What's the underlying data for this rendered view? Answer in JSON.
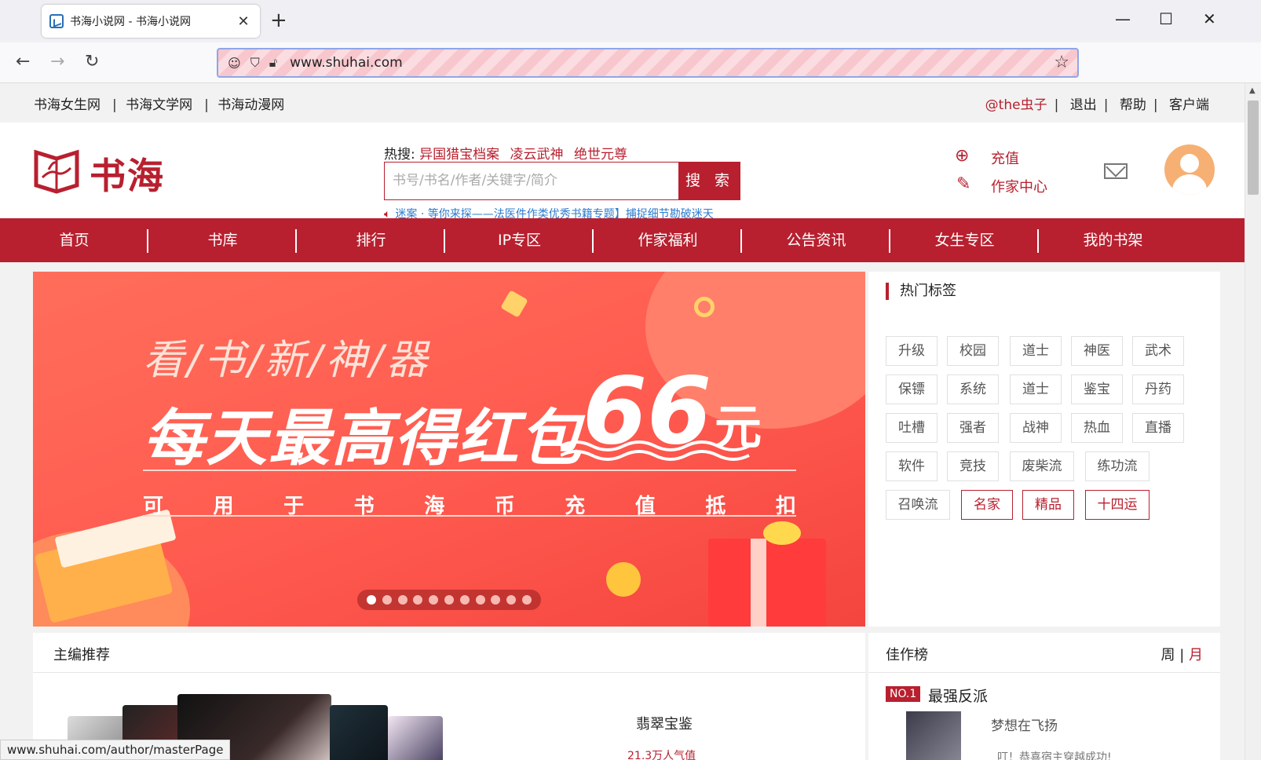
{
  "browser": {
    "tab_title": "书海小说网 - 书海小说网",
    "url": "www.shuhai.com",
    "status_url": "www.shuhai.com/author/masterPage"
  },
  "topbar": {
    "links": [
      "书海女生网",
      "书海文学网",
      "书海动漫网"
    ],
    "user": "@the虫子",
    "logout": "退出",
    "help": "帮助",
    "client": "客户端"
  },
  "header": {
    "logo_text": "书海",
    "hot_label": "热搜:",
    "hot_keywords": [
      "异国猎宝档案",
      "凌云武神",
      "绝世元尊"
    ],
    "search_placeholder": "书号/书名/作者/关键字/简介",
    "search_button": "搜 索",
    "notice": "迷案 · 等你来探——法医件作类优秀书籍专题】捕捉细节勘破迷天",
    "recharge": "充值",
    "writer_center": "作家中心"
  },
  "menu": [
    "首页",
    "书库",
    "排行",
    "IP专区",
    "作家福利",
    "公告资讯",
    "女生专区",
    "我的书架"
  ],
  "banner": {
    "line1": "看/书/新/神/器",
    "line2": "每天最高得红包",
    "amount": "66",
    "unit": "元",
    "line3": [
      "可",
      "用",
      "于",
      "书",
      "海",
      "币",
      "充",
      "值",
      "抵",
      "扣"
    ],
    "slide_count": 11,
    "active_slide": 0
  },
  "tags": {
    "title": "热门标签",
    "items": [
      {
        "label": "升级",
        "highlight": false
      },
      {
        "label": "校园",
        "highlight": false
      },
      {
        "label": "道士",
        "highlight": false
      },
      {
        "label": "神医",
        "highlight": false
      },
      {
        "label": "武术",
        "highlight": false
      },
      {
        "label": "保镖",
        "highlight": false
      },
      {
        "label": "系统",
        "highlight": false
      },
      {
        "label": "道士",
        "highlight": false
      },
      {
        "label": "鉴宝",
        "highlight": false
      },
      {
        "label": "丹药",
        "highlight": false
      },
      {
        "label": "吐槽",
        "highlight": false
      },
      {
        "label": "强者",
        "highlight": false
      },
      {
        "label": "战神",
        "highlight": false
      },
      {
        "label": "热血",
        "highlight": false
      },
      {
        "label": "直播",
        "highlight": false
      },
      {
        "label": "软件",
        "highlight": false
      },
      {
        "label": "竞技",
        "highlight": false
      },
      {
        "label": "废柴流",
        "highlight": false
      },
      {
        "label": "练功流",
        "highlight": false
      },
      {
        "label": "召唤流",
        "highlight": false
      },
      {
        "label": "名家",
        "highlight": true
      },
      {
        "label": "精品",
        "highlight": true
      },
      {
        "label": "十四运",
        "highlight": true
      }
    ]
  },
  "editor_rec": {
    "title": "主编推荐",
    "book_name": "翡翠宝鉴",
    "popularity": "21.3万人气值"
  },
  "best_works": {
    "title": "佳作榜",
    "tab_week": "周",
    "tab_month": "月",
    "rank": "NO.1",
    "book_name": "最强反派",
    "author": "梦想在飞扬",
    "desc": "叮！恭喜宿主穿越成功!"
  },
  "colors": {
    "brand_red": "#b8202f",
    "link_blue": "#2b7ccf"
  }
}
